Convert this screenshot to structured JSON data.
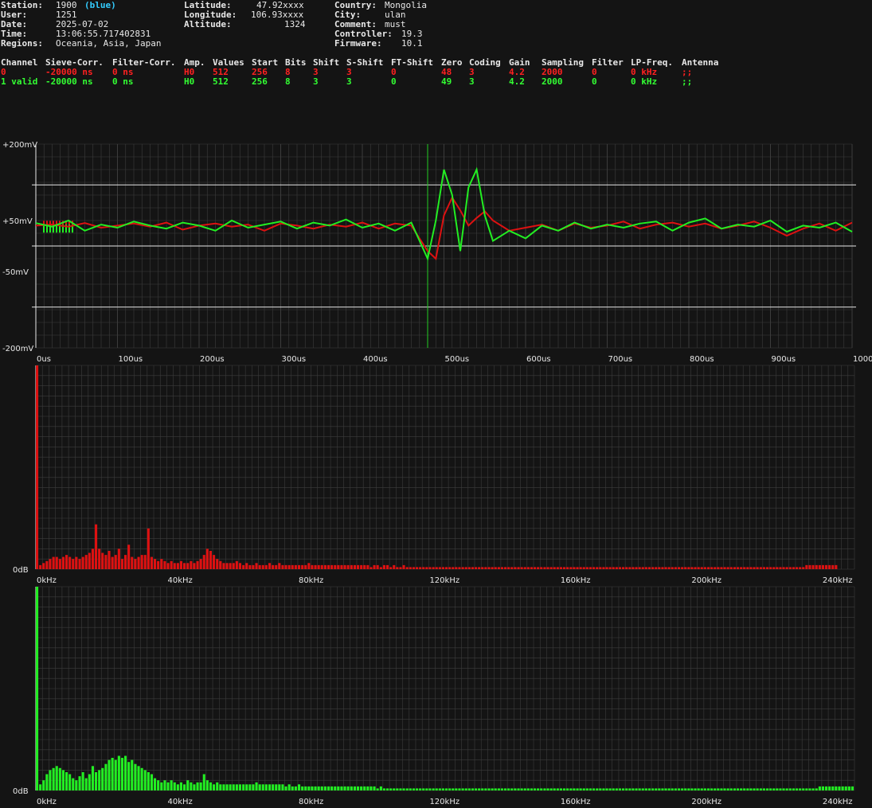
{
  "header": {
    "station_label": "Station:",
    "station_value": "1900",
    "station_color_name": "(blue)",
    "user_label": "User:",
    "user_value": "1251",
    "date_label": "Date:",
    "date_value": "2025-07-02",
    "time_label": "Time:",
    "time_value": "13:06:55.717402831",
    "regions_label": "Regions:",
    "regions_value": "Oceania, Asia, Japan",
    "latitude_label": "Latitude:",
    "latitude_value": "47.92xxxx",
    "longitude_label": "Longitude:",
    "longitude_value": "106.93xxxx",
    "altitude_label": "Altitude:",
    "altitude_value": "1324",
    "country_label": "Country:",
    "country_value": "Mongolia",
    "city_label": "City:",
    "city_value": "ulan",
    "comment_label": "Comment:",
    "comment_value": "must",
    "controller_label": "Controller:",
    "controller_value": "19.3",
    "firmware_label": "Firmware:",
    "firmware_value": "10.1"
  },
  "channel_table": {
    "columns": [
      "Channel",
      "Sieve-Corr.",
      "Filter-Corr.",
      "Amp.",
      "Values",
      "Start",
      "Bits",
      "Shift",
      "S-Shift",
      "FT-Shift",
      "Zero",
      "Coding",
      "Gain",
      "Sampling",
      "Filter",
      "LP-Freq.",
      "Antenna"
    ],
    "rows": [
      {
        "color": "#ff2020",
        "cells": [
          "0",
          "-20000 ns",
          "0 ns",
          "H0",
          "512",
          "256",
          "8",
          "3",
          "3",
          "0",
          "48",
          "3",
          "4.2",
          "2000",
          "0",
          "0 kHz",
          ";;"
        ]
      },
      {
        "color": "#33ff33",
        "cells": [
          "1 valid",
          "-20000 ns",
          "0 ns",
          "H0",
          "512",
          "256",
          "8",
          "3",
          "3",
          "0",
          "49",
          "3",
          "4.2",
          "2000",
          "0",
          "0 kHz",
          ";;"
        ]
      }
    ]
  },
  "colors": {
    "background": "#141414",
    "grid": "#3c3c3c",
    "channel0": "#dd1111",
    "channel1": "#22ee22",
    "trigger": "#22cc22"
  },
  "chart_data": [
    {
      "type": "line",
      "ylabel_ticks": [
        "+200mV",
        "+50mV",
        "-50mV",
        "-200mV"
      ],
      "y_ticks": [
        200,
        50,
        -50,
        -200
      ],
      "ylim": [
        -200,
        200
      ],
      "xlim": [
        0,
        1000
      ],
      "x_ticks": [
        0,
        100,
        200,
        300,
        400,
        500,
        600,
        700,
        800,
        900,
        1000
      ],
      "x_tick_labels": [
        "0us",
        "100us",
        "200us",
        "300us",
        "400us",
        "500us",
        "600us",
        "700us",
        "800us",
        "900us",
        "1000us"
      ],
      "reference_lines_mV": [
        0,
        120,
        -120
      ],
      "trigger_us": 480,
      "series": [
        {
          "color": "#dd1111",
          "x": [
            0,
            20,
            40,
            60,
            80,
            100,
            120,
            140,
            160,
            180,
            200,
            220,
            240,
            260,
            280,
            300,
            320,
            340,
            360,
            380,
            400,
            420,
            440,
            460,
            480,
            490,
            500,
            510,
            520,
            530,
            540,
            550,
            560,
            580,
            600,
            620,
            640,
            660,
            680,
            700,
            720,
            740,
            760,
            780,
            800,
            820,
            840,
            860,
            880,
            900,
            920,
            940,
            960,
            980,
            1000
          ],
          "y": [
            40,
            42,
            38,
            45,
            36,
            40,
            44,
            38,
            46,
            32,
            40,
            44,
            38,
            42,
            30,
            44,
            40,
            34,
            42,
            38,
            46,
            34,
            44,
            40,
            -10,
            -25,
            60,
            95,
            70,
            40,
            55,
            68,
            50,
            30,
            36,
            42,
            30,
            44,
            36,
            40,
            48,
            34,
            42,
            46,
            38,
            44,
            34,
            40,
            48,
            36,
            20,
            34,
            44,
            30,
            46
          ]
        },
        {
          "color": "#22ee22",
          "x": [
            0,
            20,
            40,
            60,
            80,
            100,
            120,
            140,
            160,
            180,
            200,
            220,
            240,
            260,
            280,
            300,
            320,
            340,
            360,
            380,
            400,
            420,
            440,
            460,
            480,
            490,
            500,
            510,
            520,
            530,
            540,
            550,
            560,
            570,
            580,
            600,
            620,
            640,
            660,
            680,
            700,
            720,
            740,
            760,
            780,
            800,
            820,
            840,
            860,
            880,
            900,
            920,
            940,
            960,
            980,
            1000
          ],
          "y": [
            45,
            38,
            50,
            30,
            42,
            36,
            48,
            40,
            34,
            46,
            40,
            30,
            50,
            36,
            42,
            48,
            34,
            46,
            40,
            52,
            36,
            44,
            30,
            46,
            -25,
            50,
            150,
            100,
            -10,
            115,
            150,
            60,
            10,
            20,
            30,
            15,
            40,
            30,
            46,
            34,
            42,
            36,
            44,
            48,
            30,
            46,
            54,
            34,
            42,
            38,
            50,
            28,
            40,
            36,
            46,
            28
          ]
        }
      ]
    },
    {
      "type": "bar",
      "title": "",
      "xlim": [
        0,
        250
      ],
      "x_tick_labels": [
        "0kHz",
        "40kHz",
        "80kHz",
        "120kHz",
        "160kHz",
        "200kHz",
        "240kHz"
      ],
      "x_ticks": [
        0,
        40,
        80,
        120,
        160,
        200,
        240
      ],
      "ylabel_tick": "0dB",
      "color": "#dd1111",
      "bin_kHz": 1.0,
      "values": [
        1.0,
        0.02,
        0.03,
        0.04,
        0.05,
        0.06,
        0.06,
        0.05,
        0.06,
        0.07,
        0.06,
        0.05,
        0.06,
        0.05,
        0.06,
        0.07,
        0.08,
        0.1,
        0.22,
        0.1,
        0.08,
        0.07,
        0.09,
        0.06,
        0.07,
        0.1,
        0.05,
        0.07,
        0.12,
        0.06,
        0.05,
        0.06,
        0.07,
        0.07,
        0.2,
        0.06,
        0.05,
        0.04,
        0.05,
        0.04,
        0.03,
        0.04,
        0.03,
        0.03,
        0.04,
        0.03,
        0.03,
        0.04,
        0.03,
        0.04,
        0.05,
        0.07,
        0.1,
        0.09,
        0.07,
        0.05,
        0.04,
        0.03,
        0.03,
        0.03,
        0.03,
        0.04,
        0.03,
        0.02,
        0.03,
        0.02,
        0.02,
        0.03,
        0.02,
        0.02,
        0.02,
        0.03,
        0.02,
        0.02,
        0.03,
        0.02,
        0.02,
        0.02,
        0.02,
        0.02,
        0.02,
        0.02,
        0.02,
        0.03,
        0.02,
        0.02,
        0.02,
        0.02,
        0.02,
        0.02,
        0.02,
        0.02,
        0.02,
        0.02,
        0.02,
        0.02,
        0.02,
        0.02,
        0.02,
        0.02,
        0.02,
        0.02,
        0.01,
        0.02,
        0.02,
        0.01,
        0.02,
        0.02,
        0.01,
        0.02,
        0.01,
        0.01,
        0.02,
        0.01,
        0.01,
        0.01,
        0.01,
        0.01,
        0.01,
        0.01,
        0.01,
        0.01,
        0.01,
        0.01,
        0.01,
        0.01,
        0.01,
        0.01,
        0.01,
        0.01,
        0.01,
        0.01,
        0.01,
        0.01,
        0.01,
        0.01,
        0.01,
        0.01,
        0.01,
        0.01,
        0.01,
        0.01,
        0.01,
        0.01,
        0.01,
        0.01,
        0.01,
        0.01,
        0.01,
        0.01,
        0.01,
        0.01,
        0.01,
        0.01,
        0.01,
        0.01,
        0.01,
        0.01,
        0.01,
        0.01,
        0.01,
        0.01,
        0.01,
        0.01,
        0.01,
        0.01,
        0.01,
        0.01,
        0.01,
        0.01,
        0.01,
        0.01,
        0.01,
        0.01,
        0.01,
        0.01,
        0.01,
        0.01,
        0.01,
        0.01,
        0.01,
        0.01,
        0.01,
        0.01,
        0.01,
        0.01,
        0.01,
        0.01,
        0.01,
        0.01,
        0.01,
        0.01,
        0.01,
        0.01,
        0.01,
        0.01,
        0.01,
        0.01,
        0.01,
        0.01,
        0.01,
        0.01,
        0.01,
        0.01,
        0.01,
        0.01,
        0.01,
        0.01,
        0.01,
        0.01,
        0.01,
        0.01,
        0.01,
        0.01,
        0.01,
        0.01,
        0.01,
        0.01,
        0.01,
        0.01,
        0.01,
        0.01,
        0.01,
        0.01,
        0.01,
        0.01,
        0.01,
        0.01,
        0.01,
        0.01,
        0.01,
        0.01,
        0.01,
        0.01,
        0.01,
        0.02,
        0.02,
        0.02,
        0.02,
        0.02,
        0.02,
        0.02,
        0.02,
        0.02,
        0.02
      ]
    },
    {
      "type": "bar",
      "title": "",
      "xlim": [
        0,
        250
      ],
      "x_tick_labels": [
        "0kHz",
        "40kHz",
        "80kHz",
        "120kHz",
        "160kHz",
        "200kHz",
        "240kHz"
      ],
      "x_ticks": [
        0,
        40,
        80,
        120,
        160,
        200,
        240
      ],
      "ylabel_tick": "0dB",
      "color": "#22ee22",
      "bin_kHz": 1.0,
      "values": [
        1.0,
        0.03,
        0.05,
        0.08,
        0.1,
        0.11,
        0.12,
        0.11,
        0.1,
        0.09,
        0.08,
        0.06,
        0.05,
        0.07,
        0.09,
        0.06,
        0.08,
        0.12,
        0.09,
        0.1,
        0.11,
        0.13,
        0.15,
        0.16,
        0.15,
        0.17,
        0.16,
        0.17,
        0.14,
        0.15,
        0.13,
        0.12,
        0.11,
        0.1,
        0.09,
        0.08,
        0.06,
        0.05,
        0.04,
        0.05,
        0.04,
        0.05,
        0.04,
        0.03,
        0.04,
        0.03,
        0.05,
        0.04,
        0.03,
        0.04,
        0.04,
        0.08,
        0.05,
        0.04,
        0.03,
        0.04,
        0.03,
        0.03,
        0.03,
        0.03,
        0.03,
        0.03,
        0.03,
        0.03,
        0.03,
        0.03,
        0.03,
        0.04,
        0.03,
        0.03,
        0.03,
        0.03,
        0.03,
        0.03,
        0.03,
        0.03,
        0.02,
        0.03,
        0.02,
        0.02,
        0.03,
        0.02,
        0.02,
        0.02,
        0.02,
        0.02,
        0.02,
        0.02,
        0.02,
        0.02,
        0.02,
        0.02,
        0.02,
        0.02,
        0.02,
        0.02,
        0.02,
        0.02,
        0.02,
        0.02,
        0.02,
        0.02,
        0.02,
        0.02,
        0.01,
        0.02,
        0.01,
        0.01,
        0.01,
        0.01,
        0.01,
        0.01,
        0.01,
        0.01,
        0.01,
        0.01,
        0.01,
        0.01,
        0.01,
        0.01,
        0.01,
        0.01,
        0.01,
        0.01,
        0.01,
        0.01,
        0.01,
        0.01,
        0.01,
        0.01,
        0.01,
        0.01,
        0.01,
        0.01,
        0.01,
        0.01,
        0.01,
        0.01,
        0.01,
        0.01,
        0.01,
        0.01,
        0.01,
        0.01,
        0.01,
        0.01,
        0.01,
        0.01,
        0.01,
        0.01,
        0.01,
        0.01,
        0.01,
        0.01,
        0.01,
        0.01,
        0.01,
        0.01,
        0.01,
        0.01,
        0.01,
        0.01,
        0.01,
        0.01,
        0.01,
        0.01,
        0.01,
        0.01,
        0.01,
        0.01,
        0.01,
        0.01,
        0.01,
        0.01,
        0.01,
        0.01,
        0.01,
        0.01,
        0.01,
        0.01,
        0.01,
        0.01,
        0.01,
        0.01,
        0.01,
        0.01,
        0.01,
        0.01,
        0.01,
        0.01,
        0.01,
        0.01,
        0.01,
        0.01,
        0.01,
        0.01,
        0.01,
        0.01,
        0.01,
        0.01,
        0.01,
        0.01,
        0.01,
        0.01,
        0.01,
        0.01,
        0.01,
        0.01,
        0.01,
        0.01,
        0.01,
        0.01,
        0.01,
        0.01,
        0.01,
        0.01,
        0.01,
        0.01,
        0.01,
        0.01,
        0.01,
        0.01,
        0.01,
        0.01,
        0.01,
        0.01,
        0.01,
        0.01,
        0.01,
        0.01,
        0.01,
        0.01,
        0.01,
        0.01,
        0.01,
        0.01,
        0.01,
        0.01,
        0.01,
        0.02,
        0.02,
        0.02,
        0.02,
        0.02,
        0.02,
        0.02,
        0.02,
        0.02,
        0.02,
        0.02
      ]
    }
  ]
}
